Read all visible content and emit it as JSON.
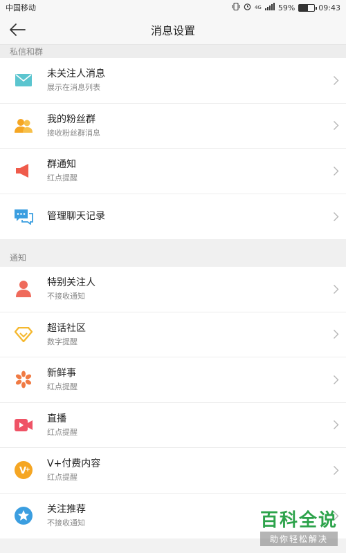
{
  "status": {
    "carrier": "中国移动",
    "battery": "59%",
    "battery_level": 0.59,
    "time": "09:43",
    "network": "4G"
  },
  "header": {
    "title": "消息设置",
    "back_icon": "back-arrow-icon"
  },
  "sections": [
    {
      "title": "私信和群",
      "items": [
        {
          "title": "未关注人消息",
          "subtitle": "展示在消息列表",
          "icon": "mail-icon",
          "color": "#5bc5cf"
        },
        {
          "title": "我的粉丝群",
          "subtitle": "接收粉丝群消息",
          "icon": "group-icon",
          "color": "#f5a623"
        },
        {
          "title": "群通知",
          "subtitle": "红点提醒",
          "icon": "megaphone-icon",
          "color": "#ef5b4b"
        },
        {
          "title": "管理聊天记录",
          "subtitle": "",
          "icon": "chat-icon",
          "color": "#3b9ee0"
        }
      ]
    },
    {
      "title": "通知",
      "items": [
        {
          "title": "特别关注人",
          "subtitle": "不接收通知",
          "icon": "person-icon",
          "color": "#ef6a5b"
        },
        {
          "title": "超话社区",
          "subtitle": "数字提醒",
          "icon": "diamond-icon",
          "color": "#f5b82e"
        },
        {
          "title": "新鲜事",
          "subtitle": "红点提醒",
          "icon": "flower-icon",
          "color": "#f07a43"
        },
        {
          "title": "直播",
          "subtitle": "红点提醒",
          "icon": "video-icon",
          "color": "#ef5366"
        },
        {
          "title": "V+付费内容",
          "subtitle": "红点提醒",
          "icon": "vplus-icon",
          "color": "#f5a623"
        },
        {
          "title": "关注推荐",
          "subtitle": "不接收通知",
          "icon": "star-icon",
          "color": "#3b9ee0"
        }
      ]
    }
  ],
  "watermark": {
    "main": "百科全说",
    "sub": "助你轻松解决"
  }
}
